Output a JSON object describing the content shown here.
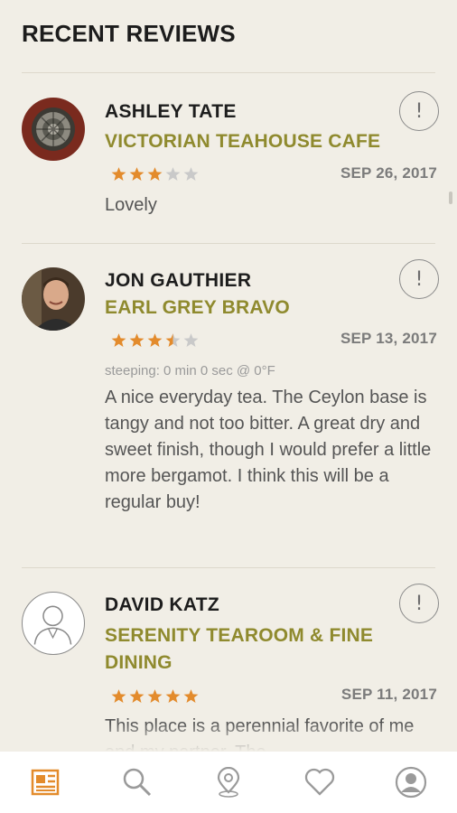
{
  "header": {
    "title": "RECENT REVIEWS"
  },
  "reviews": [
    {
      "user": "ASHLEY TATE",
      "place": "VICTORIAN TEAHOUSE CAFE",
      "rating": 3,
      "date": "SEP 26, 2017",
      "steeping": "",
      "text": "Lovely",
      "flag_label": "!"
    },
    {
      "user": "JON GAUTHIER",
      "place": "EARL GREY BRAVO",
      "rating": 3.5,
      "date": "SEP 13, 2017",
      "steeping": "steeping: 0 min 0 sec @ 0°F",
      "text": "A nice everyday tea. The Ceylon base is tangy and not too bitter. A great dry and sweet finish, though I would prefer a little more bergamot. I think this will be a regular buy!",
      "flag_label": "!"
    },
    {
      "user": "DAVID KATZ",
      "place": "SERENITY TEAROOM & FINE DINING",
      "rating": 5,
      "date": "SEP 11, 2017",
      "steeping": "",
      "text": "This place is a perennial favorite of me and my partner. The",
      "flag_label": "!"
    }
  ],
  "bottom_nav": {
    "items": [
      {
        "icon": "news-icon",
        "active": true
      },
      {
        "icon": "search-icon",
        "active": false
      },
      {
        "icon": "location-pin-icon",
        "active": false
      },
      {
        "icon": "heart-icon",
        "active": false
      },
      {
        "icon": "profile-icon",
        "active": false
      }
    ]
  },
  "colors": {
    "background": "#f1eee6",
    "accent_gold": "#8f8a2e",
    "star_filled": "#e38b2c",
    "star_empty": "#c9c9c9",
    "nav_active": "#e38b2c",
    "nav_inactive": "#9a9a9a"
  }
}
